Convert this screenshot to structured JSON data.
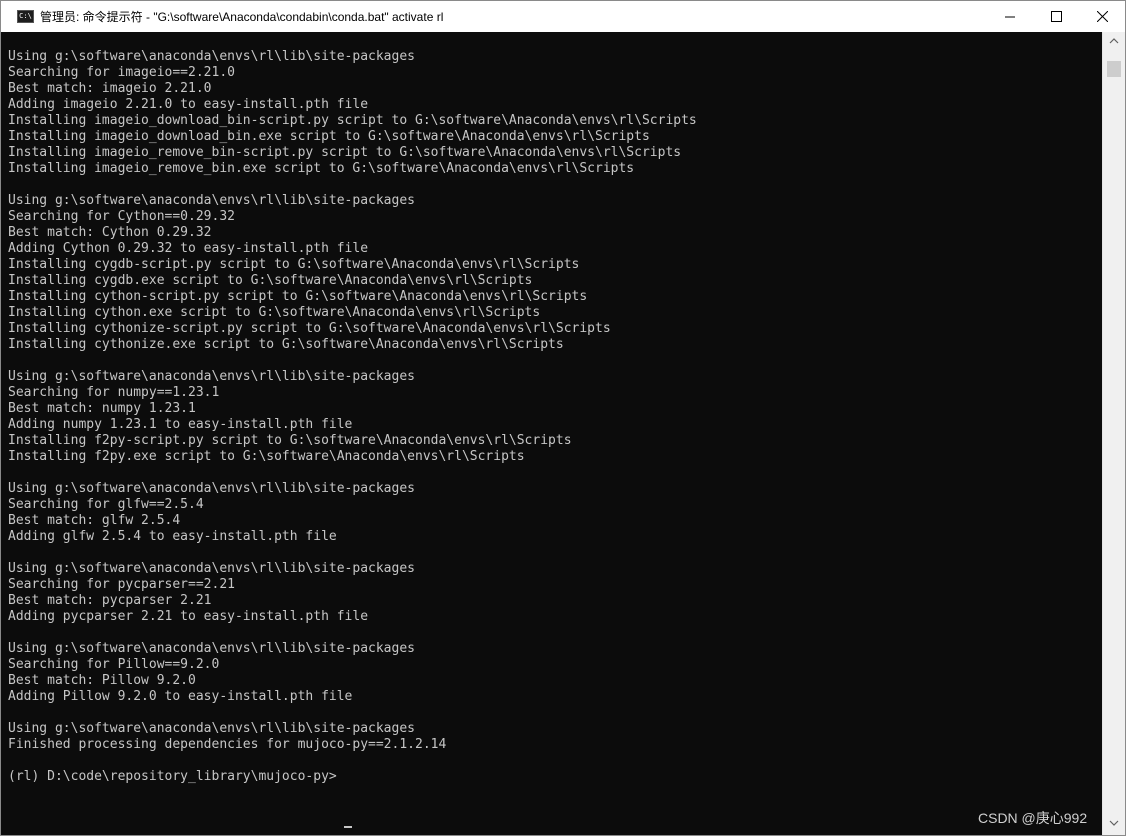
{
  "window": {
    "title": "管理员: 命令提示符 - \"G:\\software\\Anaconda\\condabin\\conda.bat\"  activate rl"
  },
  "console": {
    "lines": [
      "Using g:\\software\\anaconda\\envs\\rl\\lib\\site-packages",
      "Searching for imageio==2.21.0",
      "Best match: imageio 2.21.0",
      "Adding imageio 2.21.0 to easy-install.pth file",
      "Installing imageio_download_bin-script.py script to G:\\software\\Anaconda\\envs\\rl\\Scripts",
      "Installing imageio_download_bin.exe script to G:\\software\\Anaconda\\envs\\rl\\Scripts",
      "Installing imageio_remove_bin-script.py script to G:\\software\\Anaconda\\envs\\rl\\Scripts",
      "Installing imageio_remove_bin.exe script to G:\\software\\Anaconda\\envs\\rl\\Scripts",
      "",
      "Using g:\\software\\anaconda\\envs\\rl\\lib\\site-packages",
      "Searching for Cython==0.29.32",
      "Best match: Cython 0.29.32",
      "Adding Cython 0.29.32 to easy-install.pth file",
      "Installing cygdb-script.py script to G:\\software\\Anaconda\\envs\\rl\\Scripts",
      "Installing cygdb.exe script to G:\\software\\Anaconda\\envs\\rl\\Scripts",
      "Installing cython-script.py script to G:\\software\\Anaconda\\envs\\rl\\Scripts",
      "Installing cython.exe script to G:\\software\\Anaconda\\envs\\rl\\Scripts",
      "Installing cythonize-script.py script to G:\\software\\Anaconda\\envs\\rl\\Scripts",
      "Installing cythonize.exe script to G:\\software\\Anaconda\\envs\\rl\\Scripts",
      "",
      "Using g:\\software\\anaconda\\envs\\rl\\lib\\site-packages",
      "Searching for numpy==1.23.1",
      "Best match: numpy 1.23.1",
      "Adding numpy 1.23.1 to easy-install.pth file",
      "Installing f2py-script.py script to G:\\software\\Anaconda\\envs\\rl\\Scripts",
      "Installing f2py.exe script to G:\\software\\Anaconda\\envs\\rl\\Scripts",
      "",
      "Using g:\\software\\anaconda\\envs\\rl\\lib\\site-packages",
      "Searching for glfw==2.5.4",
      "Best match: glfw 2.5.4",
      "Adding glfw 2.5.4 to easy-install.pth file",
      "",
      "Using g:\\software\\anaconda\\envs\\rl\\lib\\site-packages",
      "Searching for pycparser==2.21",
      "Best match: pycparser 2.21",
      "Adding pycparser 2.21 to easy-install.pth file",
      "",
      "Using g:\\software\\anaconda\\envs\\rl\\lib\\site-packages",
      "Searching for Pillow==9.2.0",
      "Best match: Pillow 9.2.0",
      "Adding Pillow 9.2.0 to easy-install.pth file",
      "",
      "Using g:\\software\\anaconda\\envs\\rl\\lib\\site-packages",
      "Finished processing dependencies for mujoco-py==2.1.2.14",
      "",
      "(rl) D:\\code\\repository_library\\mujoco-py>"
    ]
  },
  "watermark": "CSDN @庚心992"
}
